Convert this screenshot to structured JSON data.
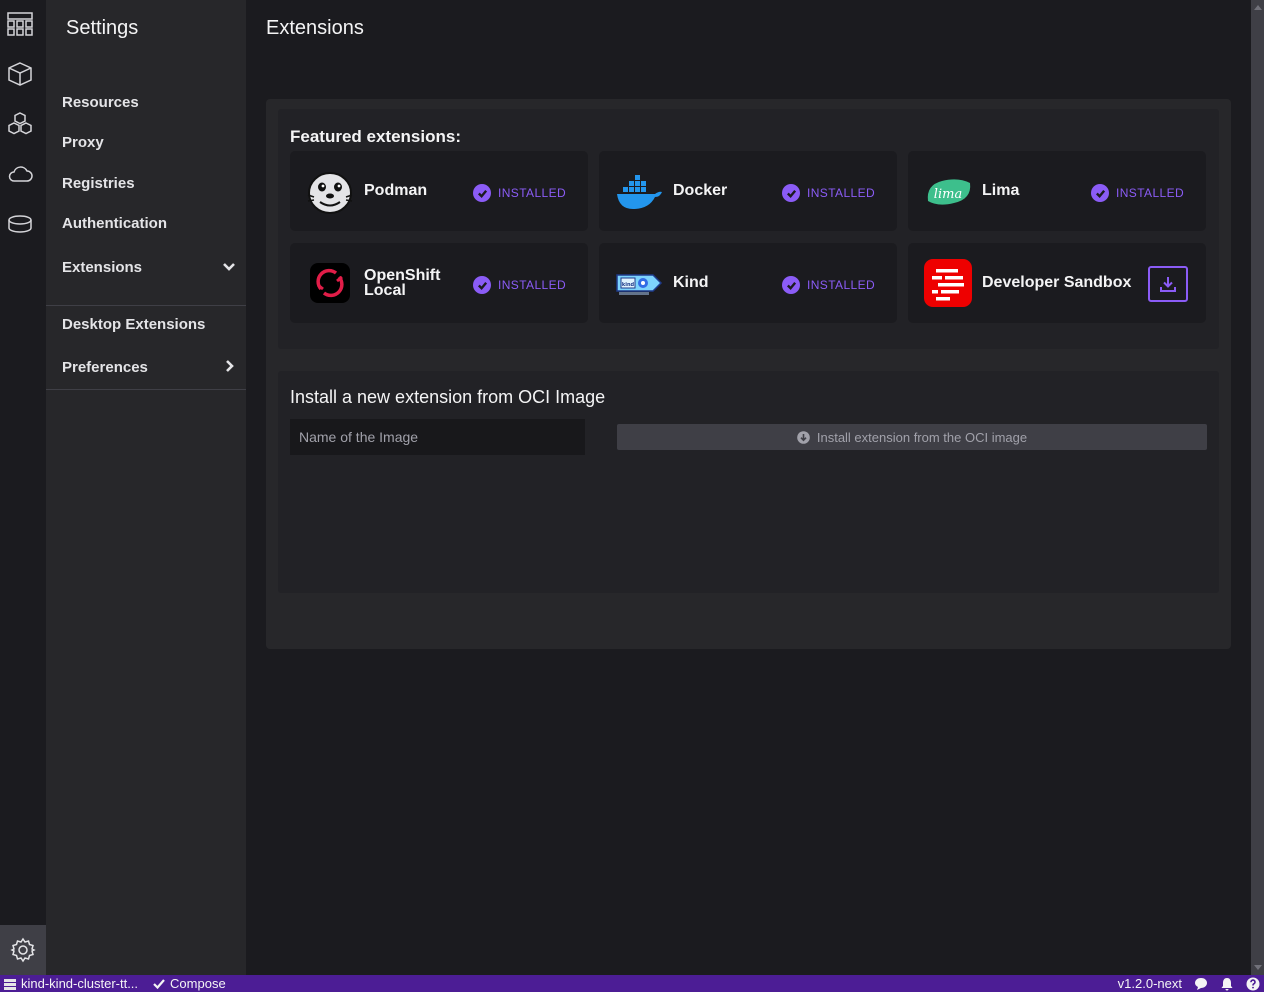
{
  "rail": {
    "icons": [
      "dashboard-icon",
      "containers-cube-icon",
      "pods-cubes-icon",
      "cloud-icon",
      "volume-disk-icon"
    ],
    "settings_icon": "gear-icon"
  },
  "nav": {
    "title": "Settings",
    "items": [
      {
        "label": "Resources"
      },
      {
        "label": "Proxy"
      },
      {
        "label": "Registries"
      },
      {
        "label": "Authentication"
      },
      {
        "label": "Extensions",
        "chevron": "chevron-down-icon"
      },
      {
        "label": "Desktop Extensions"
      },
      {
        "label": "Preferences",
        "chevron": "chevron-right-icon"
      }
    ]
  },
  "main": {
    "title": "Extensions",
    "featured": {
      "title": "Featured extensions:",
      "cards": [
        {
          "name": "Podman",
          "status": "INSTALLED",
          "logo": "podman-seal-logo"
        },
        {
          "name": "Docker",
          "status": "INSTALLED",
          "logo": "docker-whale-logo"
        },
        {
          "name": "Lima",
          "status": "INSTALLED",
          "logo": "lima-logo",
          "logo_text": "lima"
        },
        {
          "name_line1": "OpenShift",
          "name_line2": "Local",
          "status": "INSTALLED",
          "logo": "openshift-logo"
        },
        {
          "name": "Kind",
          "status": "INSTALLED",
          "logo": "kind-logo",
          "logo_text": "kind"
        },
        {
          "name": "Developer Sandbox",
          "action": "download-icon",
          "logo": "developer-sandbox-logo"
        }
      ]
    },
    "oci": {
      "title": "Install a new extension from OCI Image",
      "input_placeholder": "Name of the Image",
      "install_button": "Install extension from the OCI image"
    }
  },
  "statusbar": {
    "cluster": "kind-kind-cluster-tt...",
    "compose": "Compose",
    "version": "v1.2.0-next"
  },
  "colors": {
    "accent": "#8b5cf6",
    "statusbar": "#4c1d95",
    "background": "#1b1b1f",
    "panel": "#27272a"
  }
}
